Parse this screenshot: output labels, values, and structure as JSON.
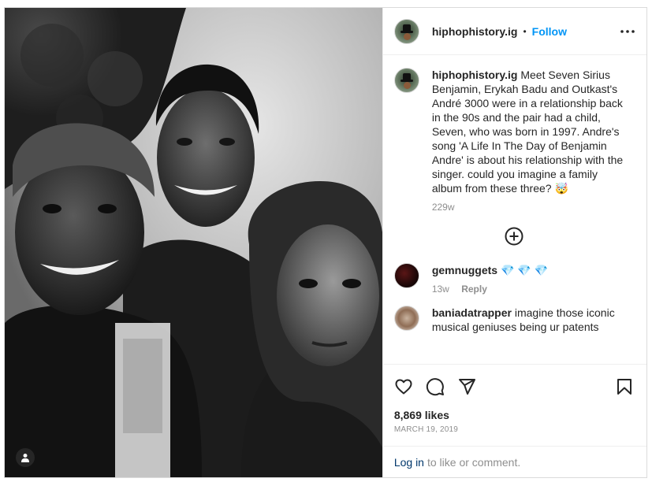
{
  "post": {
    "header": {
      "username": "hiphophistory.ig",
      "separator": "•",
      "follow_label": "Follow",
      "more_icon": "more-options-icon"
    },
    "caption": {
      "username": "hiphophistory.ig",
      "text": "Meet Seven Sirius Benjamin, Erykah Badu and Outkast's André 3000 were in a relationship back in the 90s and the pair had a child, Seven, who was born in 1997. Andre's song 'A Life In The Day of Benjamin Andre' is about his relationship with the singer. could you imagine a family album from these three? 🤯",
      "age": "229w"
    },
    "load_more_icon": "plus-circle-icon",
    "comments": [
      {
        "username": "gemnuggets",
        "text": "💎 💎 💎",
        "age": "13w",
        "reply_label": "Reply"
      },
      {
        "username": "baniadatrapper",
        "text": "imagine those iconic musical geniuses being ur patents"
      }
    ],
    "actions": {
      "icons": [
        "heart-icon",
        "comment-icon",
        "share-icon",
        "bookmark-icon"
      ]
    },
    "likes": "8,869 likes",
    "date": "MARCH 19, 2019",
    "login": {
      "link": "Log in",
      "rest": "to like or comment."
    }
  },
  "colors": {
    "accent": "#0095f6",
    "text": "#262626",
    "muted": "#8e8e8e",
    "link": "#00376b",
    "border": "#dbdbdb",
    "gem": "#1e9df2"
  }
}
